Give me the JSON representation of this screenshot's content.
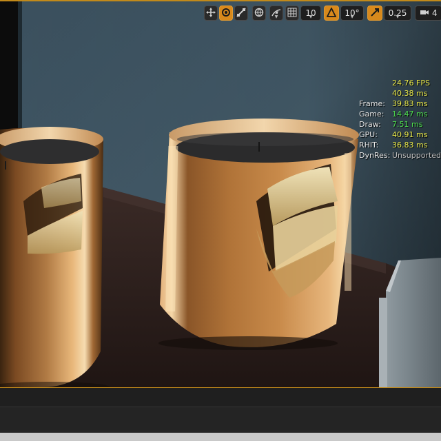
{
  "toolbar": {
    "grid_snap_value": "10",
    "rotation_snap_value": "10°",
    "scale_snap_value": "0.25",
    "camera_speed_value": "4"
  },
  "stats": {
    "fps": "24.76 FPS",
    "frame_time": "40.38 ms",
    "rows": [
      {
        "label": "Frame:",
        "value": "39.83 ms"
      },
      {
        "label": "Game:",
        "value": "14.47 ms"
      },
      {
        "label": "Draw:",
        "value": "7.51 ms"
      },
      {
        "label": "GPU:",
        "value": "40.91 ms"
      },
      {
        "label": "RHIT:",
        "value": "36.83 ms"
      },
      {
        "label": "DynRes:",
        "value": "Unsupported"
      }
    ]
  },
  "colors": {
    "accent": "#d8891c",
    "stat_yellow": "#e8e84a",
    "stat_green": "#4fe04f",
    "wall": "#3f5563",
    "table": "#2a1f1c",
    "copper": "#b87838"
  },
  "icons": [
    "move-icon",
    "rotate-icon",
    "scale-icon",
    "world-local-icon",
    "surface-snap-icon",
    "grid-icon",
    "angle-icon",
    "scale-snap-icon",
    "camera-speed-icon"
  ]
}
